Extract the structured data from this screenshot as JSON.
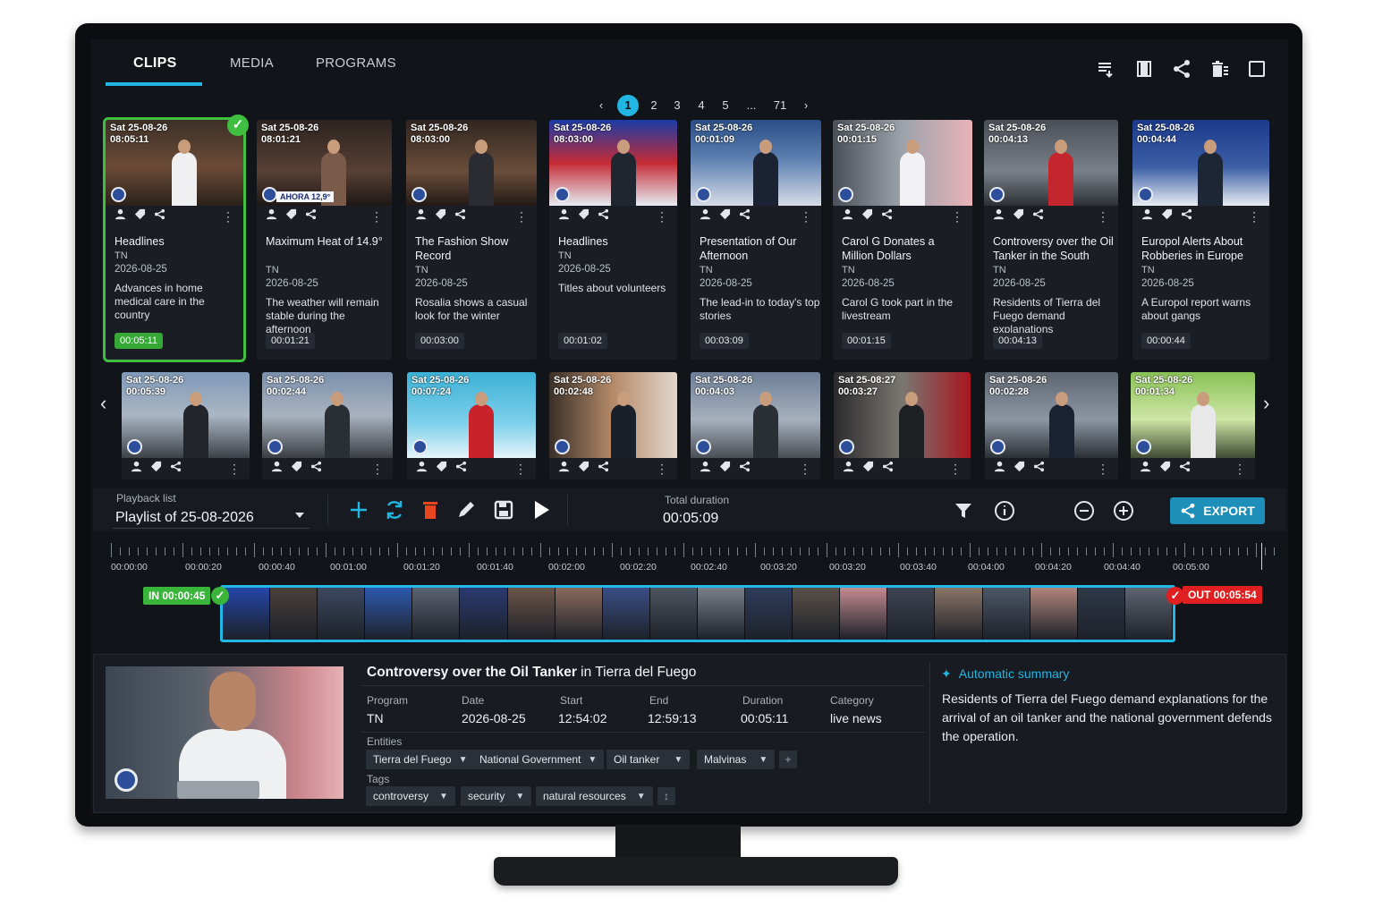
{
  "tabs": [
    {
      "label": "CLIPS",
      "active": true
    },
    {
      "label": "MEDIA",
      "active": false
    },
    {
      "label": "PROGRAMS",
      "active": false
    }
  ],
  "header_icons": [
    "playlist-add-icon",
    "film-icon",
    "share-icon",
    "delete-list-icon",
    "fullscreen-icon"
  ],
  "pagination": {
    "prev": "‹",
    "pages": [
      "1",
      "2",
      "3",
      "4",
      "5",
      "...",
      "71"
    ],
    "active": "1",
    "next": "›"
  },
  "row1": [
    {
      "stamp1": "Sat  25-08-26",
      "stamp2": "08:05:11",
      "title": "Headlines",
      "program": "TN",
      "date": "2026-08-25",
      "desc": "Advances in home medical care in the country",
      "duration": "00:05:11",
      "selected": true
    },
    {
      "stamp1": "Sat  25-08-26",
      "stamp2": "08:01:21",
      "title": "Maximum Heat of 14.9°",
      "program": "TN",
      "date": "2026-08-25",
      "desc": "The weather will remain stable during the afternoon",
      "duration": "00:01:21",
      "banner": "AHORA 12,9°"
    },
    {
      "stamp1": "Sat  25-08-26",
      "stamp2": "08:03:00",
      "title": "The Fashion Show Record",
      "program": "TN",
      "date": "2026-08-25",
      "desc": "Rosalia shows a casual look for the winter",
      "duration": "00:03:00"
    },
    {
      "stamp1": "Sat  25-08-26",
      "stamp2": "08:03:00",
      "title": "Headlines",
      "program": "TN",
      "date": "2026-08-25",
      "desc": "Titles about volunteers",
      "duration": "00:01:02"
    },
    {
      "stamp1": "Sat  25-08-26",
      "stamp2": "00:01:09",
      "title": "Presentation of Our Afternoon",
      "program": "TN",
      "date": "2026-08-25",
      "desc": "The lead-in to today's top stories",
      "duration": "00:03:09"
    },
    {
      "stamp1": "Sat  25-08-26",
      "stamp2": "00:01:15",
      "title": "Carol G Donates a Million Dollars",
      "program": "TN",
      "date": "2026-08-25",
      "desc": "Carol G took part in the livestream",
      "duration": "00:01:15"
    },
    {
      "stamp1": "Sat  25-08-26",
      "stamp2": "00:04:13",
      "title": "Controversy over the Oil Tanker in the South",
      "program": "TN",
      "date": "2026-08-25",
      "desc": "Residents of Tierra del Fuego demand explanations",
      "duration": "00:04:13"
    },
    {
      "stamp1": "Sat  25-08-26",
      "stamp2": "00:04:44",
      "title": "Europol Alerts About Robberies in Europe",
      "program": "TN",
      "date": "2026-08-25",
      "desc": "A Europol report warns about gangs",
      "duration": "00:00:44"
    }
  ],
  "row2": [
    {
      "stamp1": "Sat  25-08-26",
      "stamp2": "00:05:39"
    },
    {
      "stamp1": "Sat  25-08-26",
      "stamp2": "00:02:44"
    },
    {
      "stamp1": "Sat  25-08-26",
      "stamp2": "00:07:24"
    },
    {
      "stamp1": "Sat  25-08-26",
      "stamp2": "00:02:48"
    },
    {
      "stamp1": "Sat  25-08-26",
      "stamp2": "00:04:03"
    },
    {
      "stamp1": "Sat  25-08:27",
      "stamp2": "00:03:27"
    },
    {
      "stamp1": "Sat  25-08-26",
      "stamp2": "00:02:28"
    },
    {
      "stamp1": "Sat  25-08-26",
      "stamp2": "00:01:34"
    }
  ],
  "playback": {
    "label": "Playback list",
    "value": "Playlist of 25-08-2026",
    "total_label": "Total duration",
    "total_value": "00:05:09",
    "export_label": "EXPORT"
  },
  "timeline": {
    "labels": [
      "00:00:00",
      "00:00:20",
      "00:00:40",
      "00:01:00",
      "00:01:20",
      "00:01:40",
      "00:02:00",
      "00:02:20",
      "00:02:40",
      "00:03:20",
      "00:03:20",
      "00:03:40",
      "00:04:00",
      "00:04:20",
      "00:04:40",
      "00:05:00"
    ],
    "in_label": "IN 00:00:45",
    "out_label": "OUT 00:05:54"
  },
  "details": {
    "title_main": "Controversy over the Oil Tanker",
    "title_rest": " in Tierra del Fuego",
    "program_label": "Program",
    "program": "TN",
    "date_label": "Date",
    "date": "2026-08-25",
    "start_label": "Start",
    "start": "12:54:02",
    "end_label": "End",
    "end": "12:59:13",
    "duration_label": "Duration",
    "duration": "00:05:11",
    "category_label": "Category",
    "category": "live news",
    "entities_label": "Entities",
    "entities": [
      "Tierra del Fuego",
      "National Government",
      "Oil tanker",
      "Malvinas"
    ],
    "tags_label": "Tags",
    "tags": [
      "controversy",
      "security",
      "natural resources"
    ],
    "summary_title": "Automatic summary",
    "summary": "Residents of Tierra del Fuego demand explanations for the arrival of an oil tanker and the national government defends the operation."
  },
  "colors": {
    "accent": "#21b6e3",
    "selected": "#3fbf3f",
    "out": "#e02020",
    "delete": "#e8461f"
  }
}
